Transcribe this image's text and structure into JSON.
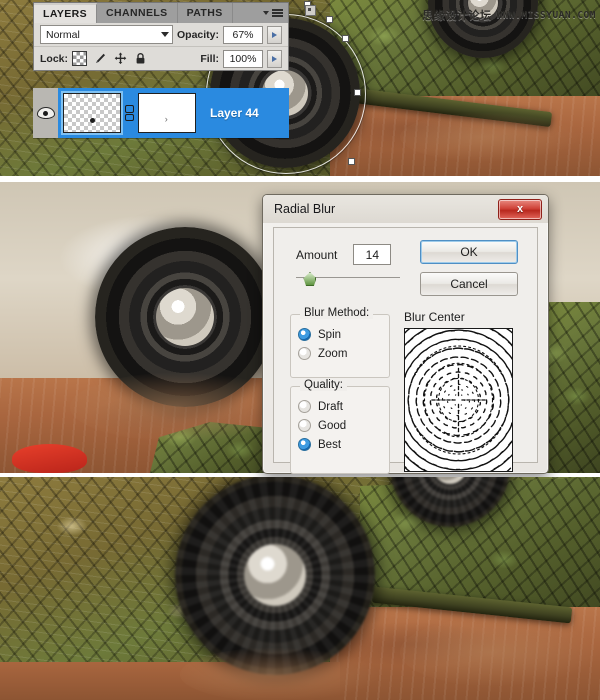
{
  "watermark": {
    "cn": "思缘设计论坛",
    "en": "WWW.MISSYUAN.COM"
  },
  "layers_panel": {
    "tabs": [
      {
        "label": "LAYERS",
        "active": true
      },
      {
        "label": "CHANNELS",
        "active": false
      },
      {
        "label": "PATHS",
        "active": false
      }
    ],
    "menu_icon": "panel-menu-icon",
    "close_icon": "panel-close-icon",
    "blend_mode": "Normal",
    "opacity_label": "Opacity:",
    "opacity_value": "67%",
    "lock_label": "Lock:",
    "lock_icons": [
      "lock-transparent-pixels-icon",
      "lock-image-pixels-icon",
      "lock-position-icon",
      "lock-all-icon"
    ],
    "fill_label": "Fill:",
    "fill_value": "100%",
    "layer": {
      "name": "Layer 44",
      "visible": true,
      "visibility_icon": "eye-icon",
      "link_icon": "link-mask-icon",
      "selected_color": "#2a8ae0"
    }
  },
  "dialog": {
    "title": "Radial Blur",
    "close_label": "x",
    "amount_label": "Amount",
    "amount_value": "14",
    "slider_position_percent": 12,
    "ok_label": "OK",
    "cancel_label": "Cancel",
    "blur_method": {
      "title": "Blur Method:",
      "options": [
        {
          "label": "Spin",
          "selected": true
        },
        {
          "label": "Zoom",
          "selected": false
        }
      ]
    },
    "quality": {
      "title": "Quality:",
      "options": [
        {
          "label": "Draft",
          "selected": false
        },
        {
          "label": "Good",
          "selected": false
        },
        {
          "label": "Best",
          "selected": true
        }
      ]
    },
    "blur_center": {
      "label": "Blur Center",
      "pattern": "spin-radial-streaks"
    }
  },
  "panels": [
    {
      "name": "step-1-layers-panel-screenshot"
    },
    {
      "name": "step-2-radial-blur-dialog-screenshot"
    },
    {
      "name": "step-3-result-screenshot"
    }
  ]
}
